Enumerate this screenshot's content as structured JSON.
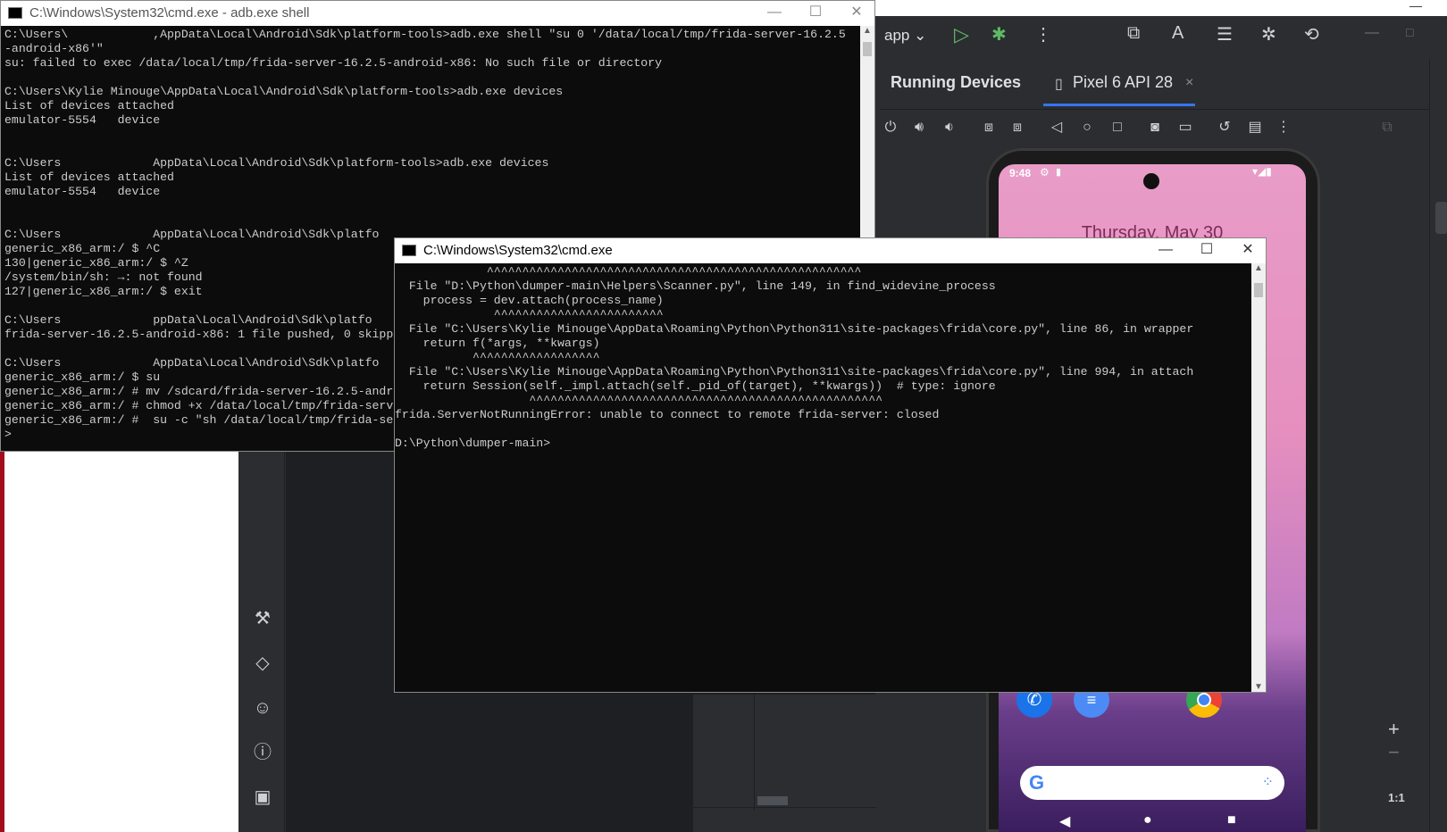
{
  "studio": {
    "run_config": "app",
    "running_devices_title": "Running Devices",
    "device_tab": "Pixel 6 API 28",
    "phone": {
      "status_time": "9:48",
      "date_text": "Thursday, May 30"
    },
    "zoom_label": "1:1"
  },
  "cmd1": {
    "title": "C:\\Windows\\System32\\cmd.exe - adb.exe  shell",
    "lines": [
      "C:\\Users\\            ,AppData\\Local\\Android\\Sdk\\platform-tools>adb.exe shell \"su 0 '/data/local/tmp/frida-server-16.2.5",
      "-android-x86'\"",
      "su: failed to exec /data/local/tmp/frida-server-16.2.5-android-x86: No such file or directory",
      "",
      "C:\\Users\\Kylie Minouge\\AppData\\Local\\Android\\Sdk\\platform-tools>adb.exe devices",
      "List of devices attached",
      "emulator-5554   device",
      "",
      "",
      "C:\\Users             AppData\\Local\\Android\\Sdk\\platform-tools>adb.exe devices",
      "List of devices attached",
      "emulator-5554   device",
      "",
      "",
      "C:\\Users             AppData\\Local\\Android\\Sdk\\platfo",
      "generic_x86_arm:/ $ ^C",
      "130|generic_x86_arm:/ $ ^Z",
      "/system/bin/sh: →: not found",
      "127|generic_x86_arm:/ $ exit",
      "",
      "C:\\Users             ppData\\Local\\Android\\Sdk\\platfo",
      "frida-server-16.2.5-android-x86: 1 file pushed, 0 skipp",
      "",
      "C:\\Users             AppData\\Local\\Android\\Sdk\\platfo",
      "generic_x86_arm:/ $ su",
      "generic_x86_arm:/ # mv /sdcard/frida-server-16.2.5-andr",
      "generic_x86_arm:/ # chmod +x /data/local/tmp/frida-serv",
      "generic_x86_arm:/ #  su -c \"sh /data/local/tmp/frida-se",
      ">"
    ]
  },
  "cmd2": {
    "title": "C:\\Windows\\System32\\cmd.exe",
    "lines": [
      "             ^^^^^^^^^^^^^^^^^^^^^^^^^^^^^^^^^^^^^^^^^^^^^^^^^^^^^",
      "  File \"D:\\Python\\dumper-main\\Helpers\\Scanner.py\", line 149, in find_widevine_process",
      "    process = dev.attach(process_name)",
      "              ^^^^^^^^^^^^^^^^^^^^^^^^",
      "  File \"C:\\Users\\Kylie Minouge\\AppData\\Roaming\\Python\\Python311\\site-packages\\frida\\core.py\", line 86, in wrapper",
      "    return f(*args, **kwargs)",
      "           ^^^^^^^^^^^^^^^^^^",
      "  File \"C:\\Users\\Kylie Minouge\\AppData\\Roaming\\Python\\Python311\\site-packages\\frida\\core.py\", line 994, in attach",
      "    return Session(self._impl.attach(self._pid_of(target), **kwargs))  # type: ignore",
      "                   ^^^^^^^^^^^^^^^^^^^^^^^^^^^^^^^^^^^^^^^^^^^^^^^^^^",
      "frida.ServerNotRunningError: unable to connect to remote frida-server: closed",
      "",
      "D:\\Python\\dumper-main>"
    ]
  }
}
